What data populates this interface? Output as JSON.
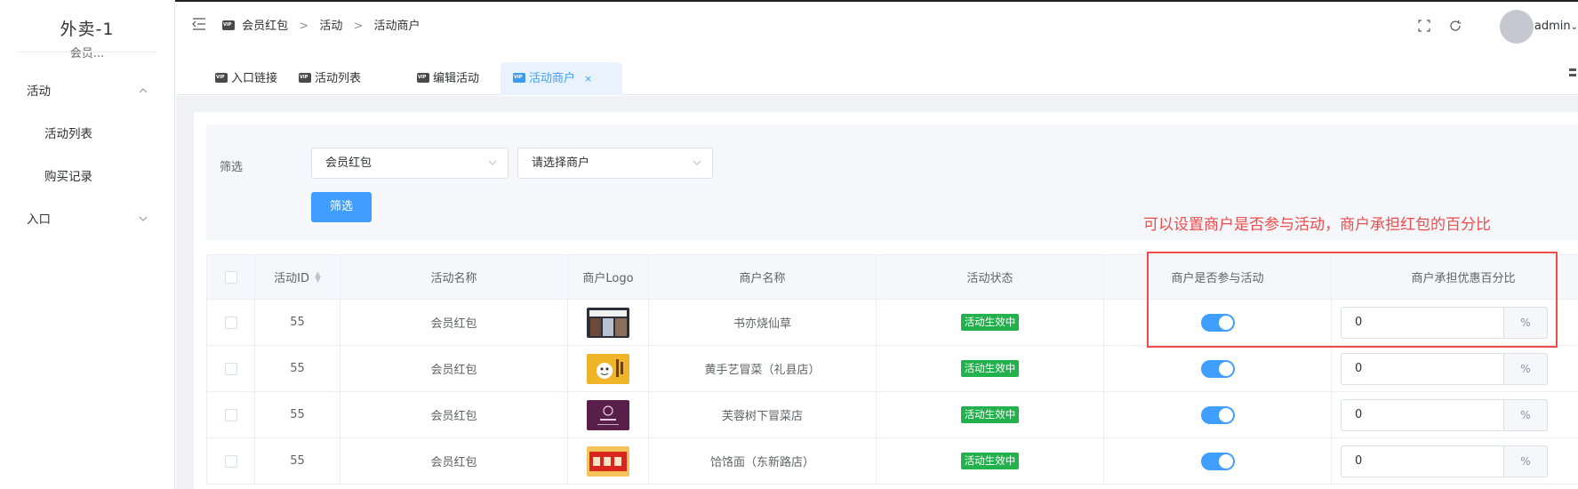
{
  "sidebar": {
    "brand_title": "外卖-1",
    "brand_sub": "会员...",
    "menu": [
      {
        "label": "活动",
        "caret": "^"
      },
      {
        "label": "活动列表"
      },
      {
        "label": "购买记录"
      },
      {
        "label": "入口",
        "caret": "v"
      }
    ]
  },
  "header": {
    "breadcrumb": [
      "会员红包",
      "活动",
      "活动商户"
    ],
    "separator": ">",
    "user": "admin"
  },
  "tabs": [
    {
      "label": "入口链接"
    },
    {
      "label": "活动列表"
    },
    {
      "label": "编辑活动"
    },
    {
      "label": "活动商户",
      "active": true,
      "close": "×"
    }
  ],
  "filter": {
    "label": "筛选",
    "activity_select": "会员红包",
    "merchant_placeholder": "请选择商户",
    "button": "筛选"
  },
  "annotation": {
    "text": "可以设置商户是否参与活动，商户承担红包的百分比",
    "color": "#f04b4b"
  },
  "table": {
    "headers": {
      "id": "活动ID",
      "name": "活动名称",
      "logo": "商户Logo",
      "merchant": "商户名称",
      "status": "活动状态",
      "participate": "商户是否参与活动",
      "percent": "商户承担优惠百分比"
    },
    "rows": [
      {
        "id": "55",
        "name": "会员红包",
        "logo": "shop-photo-logo",
        "merchant": "书亦烧仙草",
        "status": "活动生效中",
        "participate": true,
        "percent": "0",
        "unit": "%"
      },
      {
        "id": "55",
        "name": "会员红包",
        "logo": "cartoon-chef-logo",
        "merchant": "黄手艺冒菜（礼县店）",
        "status": "活动生效中",
        "participate": true,
        "percent": "0",
        "unit": "%"
      },
      {
        "id": "55",
        "name": "会员红包",
        "logo": "purple-emblem-logo",
        "merchant": "芙蓉树下冒菜店",
        "status": "活动生效中",
        "participate": true,
        "percent": "0",
        "unit": "%"
      },
      {
        "id": "55",
        "name": "会员红包",
        "logo": "red-sign-logo",
        "merchant": "饸饹面（东新路店）",
        "status": "活动生效中",
        "participate": true,
        "percent": "0",
        "unit": "%"
      }
    ]
  },
  "colors": {
    "primary": "#409eff",
    "status_green": "#22b14c",
    "annotation_red": "#f04b4b"
  }
}
